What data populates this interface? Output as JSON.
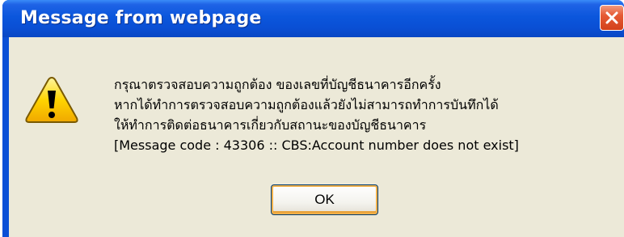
{
  "dialog": {
    "title": "Message from webpage",
    "icon": "warning-icon",
    "message_lines": [
      "กรุณาตรวจสอบความถูกต้อง ของเลขที่บัญชีธนาคารอีกครั้ง",
      "หากได้ทำการตรวจสอบความถูกต้องแล้วยังไม่สามารถทำการบันทึกได้",
      "ให้ทำการติดต่อธนาคารเกี่ยวกับสถานะของบัญชีธนาคาร",
      "[Message code : 43306 :: CBS:Account number does not exist]"
    ],
    "ok_label": "OK"
  },
  "colors": {
    "title_bar": "#0a4fd6",
    "client_bg": "#ece9d8",
    "close_button": "#d2411b",
    "warning_fill": "#ffd400"
  }
}
